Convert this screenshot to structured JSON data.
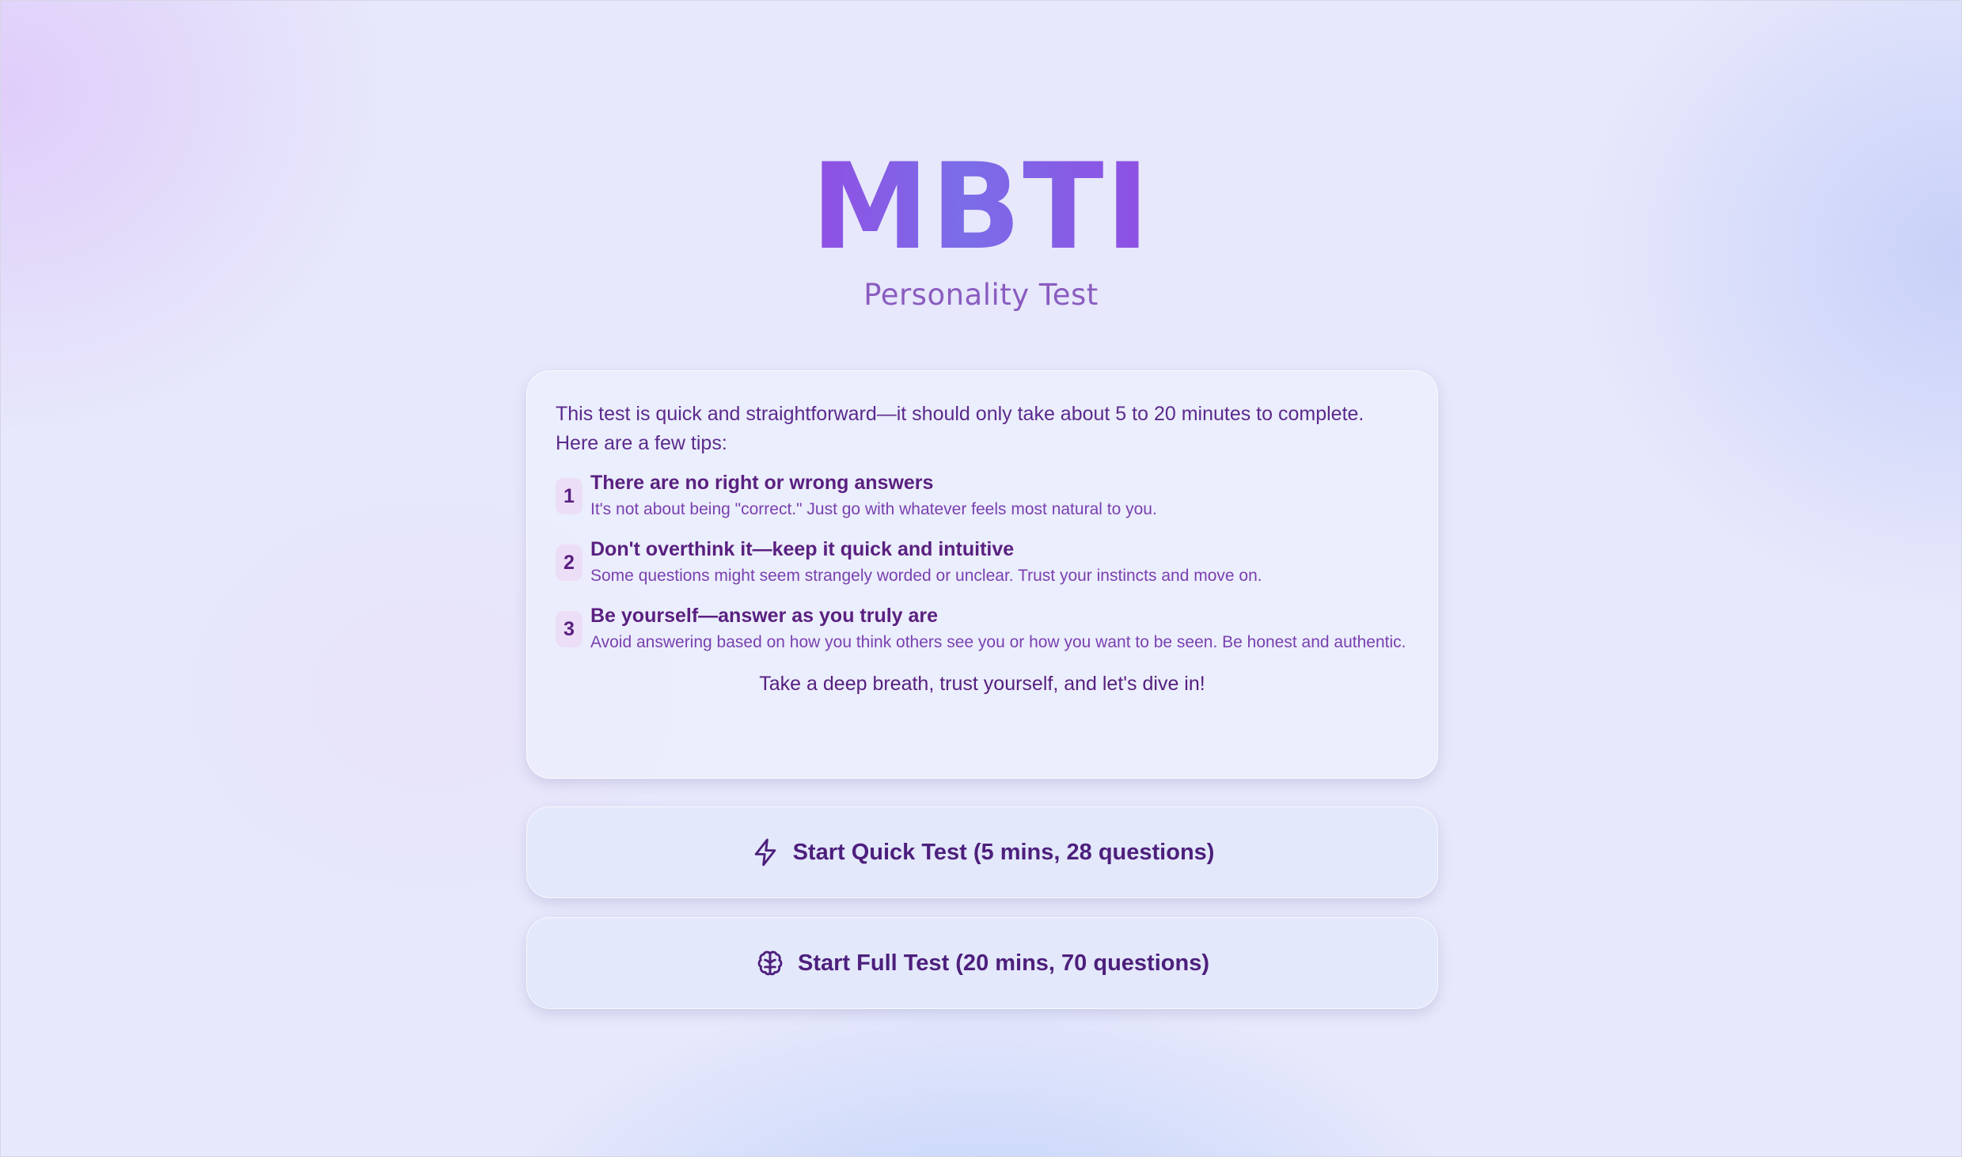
{
  "header": {
    "title": "MBTI",
    "subtitle": "Personality Test"
  },
  "intro_card": {
    "intro_text": "This test is quick and straightforward—it should only take about 5 to 20 minutes to complete. Here are a few tips:",
    "tips": [
      {
        "number": "1",
        "title": "There are no right or wrong answers",
        "description": "It's not about being \"correct.\" Just go with whatever feels most natural to you."
      },
      {
        "number": "2",
        "title": "Don't overthink it—keep it quick and intuitive",
        "description": "Some questions might seem strangely worded or unclear. Trust your instincts and move on."
      },
      {
        "number": "3",
        "title": "Be yourself—answer as you truly are",
        "description": "Avoid answering based on how you think others see you or how you want to be seen. Be honest and authentic."
      }
    ],
    "closing_text": "Take a deep breath, trust yourself, and let's dive in!"
  },
  "actions": {
    "quick_test": {
      "label": "Start Quick Test (5 mins, 28 questions)",
      "icon": "lightning-icon"
    },
    "full_test": {
      "label": "Start Full Test (20 mins, 70 questions)",
      "icon": "brain-icon"
    }
  },
  "colors": {
    "title_gradient_start": "#8f4fe3",
    "title_gradient_mid": "#7b6de8",
    "subtitle": "#8a5cc0",
    "text_primary": "#5a2080",
    "button_text": "#4d1f7c"
  }
}
